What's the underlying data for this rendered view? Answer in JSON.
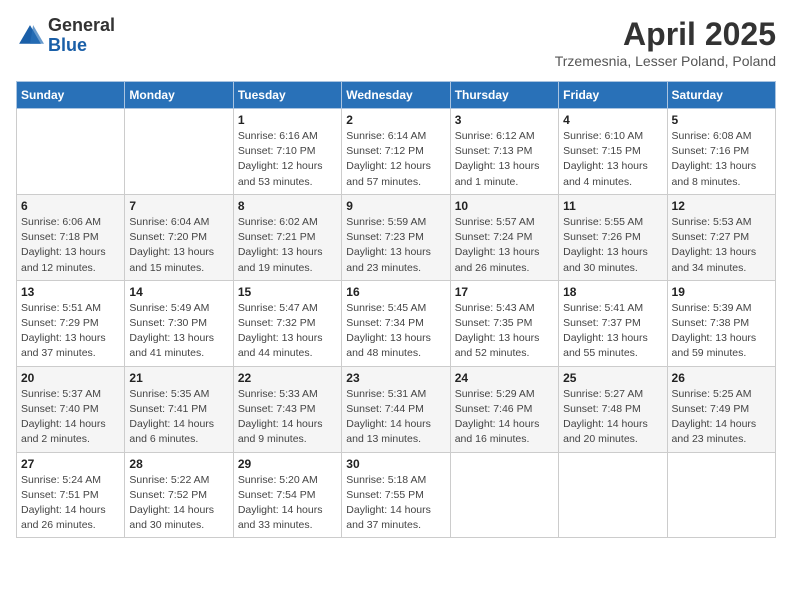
{
  "header": {
    "logo_general": "General",
    "logo_blue": "Blue",
    "month_title": "April 2025",
    "location": "Trzemesnia, Lesser Poland, Poland"
  },
  "weekdays": [
    "Sunday",
    "Monday",
    "Tuesday",
    "Wednesday",
    "Thursday",
    "Friday",
    "Saturday"
  ],
  "weeks": [
    [
      {
        "day": "",
        "info": ""
      },
      {
        "day": "",
        "info": ""
      },
      {
        "day": "1",
        "info": "Sunrise: 6:16 AM\nSunset: 7:10 PM\nDaylight: 12 hours\nand 53 minutes."
      },
      {
        "day": "2",
        "info": "Sunrise: 6:14 AM\nSunset: 7:12 PM\nDaylight: 12 hours\nand 57 minutes."
      },
      {
        "day": "3",
        "info": "Sunrise: 6:12 AM\nSunset: 7:13 PM\nDaylight: 13 hours\nand 1 minute."
      },
      {
        "day": "4",
        "info": "Sunrise: 6:10 AM\nSunset: 7:15 PM\nDaylight: 13 hours\nand 4 minutes."
      },
      {
        "day": "5",
        "info": "Sunrise: 6:08 AM\nSunset: 7:16 PM\nDaylight: 13 hours\nand 8 minutes."
      }
    ],
    [
      {
        "day": "6",
        "info": "Sunrise: 6:06 AM\nSunset: 7:18 PM\nDaylight: 13 hours\nand 12 minutes."
      },
      {
        "day": "7",
        "info": "Sunrise: 6:04 AM\nSunset: 7:20 PM\nDaylight: 13 hours\nand 15 minutes."
      },
      {
        "day": "8",
        "info": "Sunrise: 6:02 AM\nSunset: 7:21 PM\nDaylight: 13 hours\nand 19 minutes."
      },
      {
        "day": "9",
        "info": "Sunrise: 5:59 AM\nSunset: 7:23 PM\nDaylight: 13 hours\nand 23 minutes."
      },
      {
        "day": "10",
        "info": "Sunrise: 5:57 AM\nSunset: 7:24 PM\nDaylight: 13 hours\nand 26 minutes."
      },
      {
        "day": "11",
        "info": "Sunrise: 5:55 AM\nSunset: 7:26 PM\nDaylight: 13 hours\nand 30 minutes."
      },
      {
        "day": "12",
        "info": "Sunrise: 5:53 AM\nSunset: 7:27 PM\nDaylight: 13 hours\nand 34 minutes."
      }
    ],
    [
      {
        "day": "13",
        "info": "Sunrise: 5:51 AM\nSunset: 7:29 PM\nDaylight: 13 hours\nand 37 minutes."
      },
      {
        "day": "14",
        "info": "Sunrise: 5:49 AM\nSunset: 7:30 PM\nDaylight: 13 hours\nand 41 minutes."
      },
      {
        "day": "15",
        "info": "Sunrise: 5:47 AM\nSunset: 7:32 PM\nDaylight: 13 hours\nand 44 minutes."
      },
      {
        "day": "16",
        "info": "Sunrise: 5:45 AM\nSunset: 7:34 PM\nDaylight: 13 hours\nand 48 minutes."
      },
      {
        "day": "17",
        "info": "Sunrise: 5:43 AM\nSunset: 7:35 PM\nDaylight: 13 hours\nand 52 minutes."
      },
      {
        "day": "18",
        "info": "Sunrise: 5:41 AM\nSunset: 7:37 PM\nDaylight: 13 hours\nand 55 minutes."
      },
      {
        "day": "19",
        "info": "Sunrise: 5:39 AM\nSunset: 7:38 PM\nDaylight: 13 hours\nand 59 minutes."
      }
    ],
    [
      {
        "day": "20",
        "info": "Sunrise: 5:37 AM\nSunset: 7:40 PM\nDaylight: 14 hours\nand 2 minutes."
      },
      {
        "day": "21",
        "info": "Sunrise: 5:35 AM\nSunset: 7:41 PM\nDaylight: 14 hours\nand 6 minutes."
      },
      {
        "day": "22",
        "info": "Sunrise: 5:33 AM\nSunset: 7:43 PM\nDaylight: 14 hours\nand 9 minutes."
      },
      {
        "day": "23",
        "info": "Sunrise: 5:31 AM\nSunset: 7:44 PM\nDaylight: 14 hours\nand 13 minutes."
      },
      {
        "day": "24",
        "info": "Sunrise: 5:29 AM\nSunset: 7:46 PM\nDaylight: 14 hours\nand 16 minutes."
      },
      {
        "day": "25",
        "info": "Sunrise: 5:27 AM\nSunset: 7:48 PM\nDaylight: 14 hours\nand 20 minutes."
      },
      {
        "day": "26",
        "info": "Sunrise: 5:25 AM\nSunset: 7:49 PM\nDaylight: 14 hours\nand 23 minutes."
      }
    ],
    [
      {
        "day": "27",
        "info": "Sunrise: 5:24 AM\nSunset: 7:51 PM\nDaylight: 14 hours\nand 26 minutes."
      },
      {
        "day": "28",
        "info": "Sunrise: 5:22 AM\nSunset: 7:52 PM\nDaylight: 14 hours\nand 30 minutes."
      },
      {
        "day": "29",
        "info": "Sunrise: 5:20 AM\nSunset: 7:54 PM\nDaylight: 14 hours\nand 33 minutes."
      },
      {
        "day": "30",
        "info": "Sunrise: 5:18 AM\nSunset: 7:55 PM\nDaylight: 14 hours\nand 37 minutes."
      },
      {
        "day": "",
        "info": ""
      },
      {
        "day": "",
        "info": ""
      },
      {
        "day": "",
        "info": ""
      }
    ]
  ]
}
